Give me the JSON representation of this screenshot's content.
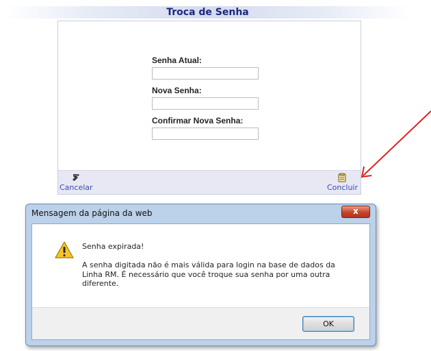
{
  "page": {
    "title": "Troca de Senha"
  },
  "form": {
    "current_password_label": "Senha Atual:",
    "current_password_value": "",
    "new_password_label": "Nova Senha:",
    "new_password_value": "",
    "confirm_password_label": "Confirmar Nova Senha:",
    "confirm_password_value": ""
  },
  "footer": {
    "cancel_label": "Cancelar",
    "conclude_label": "Concluir",
    "cancel_icon": "cancel-icon",
    "conclude_icon": "conclude-icon"
  },
  "dialog": {
    "title": "Mensagem da página da web",
    "close_label": "x",
    "icon": "warning-icon",
    "message_title": "Senha expirada!",
    "message_body": "A senha digitada não é mais válida para login na base de dados da Linha RM. É necessário que você troque sua senha por uma outra diferente.",
    "ok_label": "OK"
  },
  "annotation": {
    "arrow_color": "#e02020"
  }
}
